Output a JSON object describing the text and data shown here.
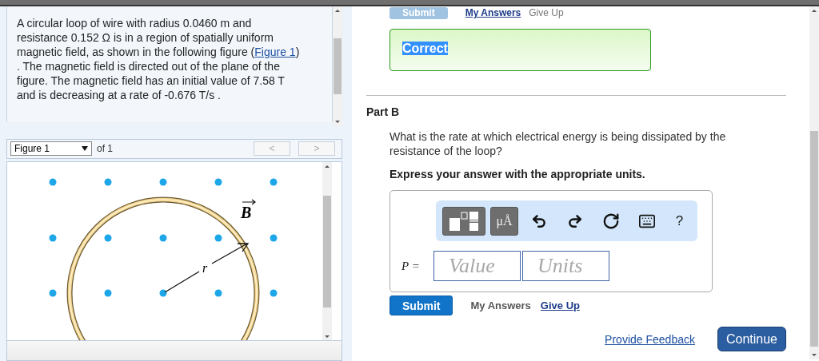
{
  "part_a_actions": {
    "submit": "Submit",
    "my_answers": "My Answers",
    "give_up": "Give Up"
  },
  "feedback": {
    "label": "Correct",
    "selected": true
  },
  "problem": {
    "text_before": "A circular loop of wire with radius 0.0460 m and resistance 0.152 Ω is in a region of spatially uniform magnetic field, as shown in the following figure (",
    "link": "Figure 1",
    "text_after": ") . The magnetic field is directed out of the plane of the figure. The magnetic field has an initial value of 7.58 T and is decreasing at a rate of -0.676 T/s ."
  },
  "figure_nav": {
    "select": "Figure 1",
    "of": "of 1",
    "prev": "<",
    "next": ">"
  },
  "figure": {
    "field_label": "B",
    "radius_label": "r"
  },
  "part_b": {
    "title": "Part B",
    "question": "What is the rate at which electrical energy is being dissipated by the resistance of the loop?",
    "instruction": "Express your answer with the appropriate units.",
    "toolbar": {
      "units_button": "μÅ",
      "help": "?"
    },
    "variable": "P =",
    "value_placeholder": "Value",
    "units_placeholder": "Units",
    "submit": "Submit",
    "my_answers": "My Answers",
    "give_up": "Give Up"
  },
  "footer": {
    "feedback_link": "Provide Feedback",
    "continue": "Continue"
  }
}
